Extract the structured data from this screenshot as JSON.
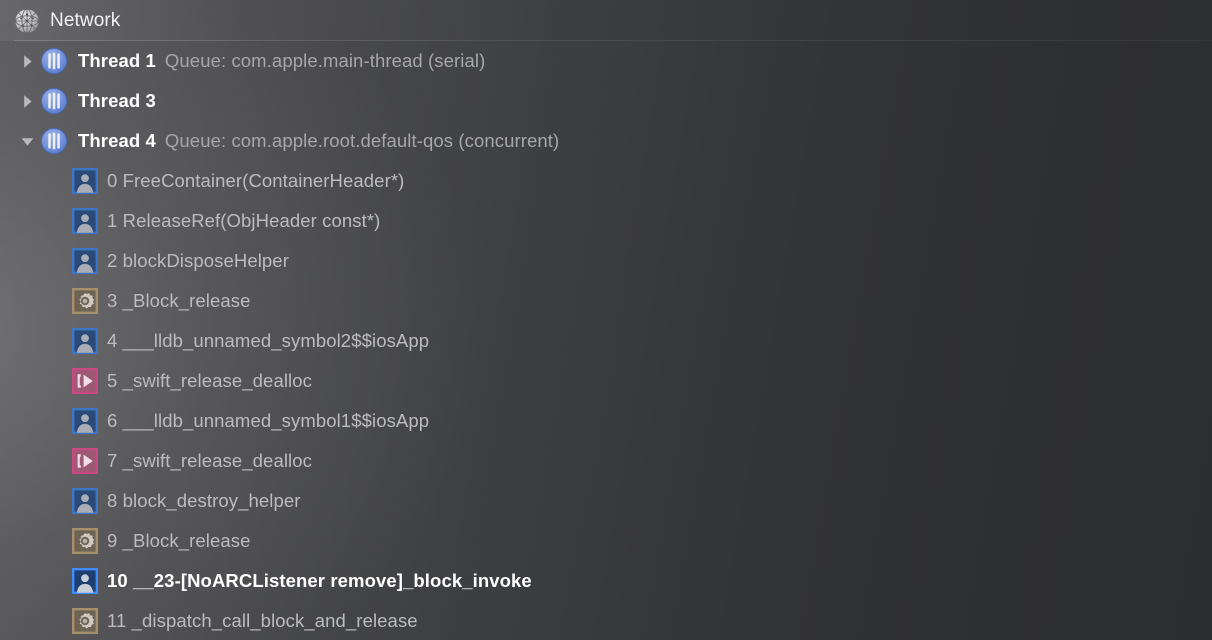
{
  "header": {
    "title": "Network",
    "icon": "network-globe-icon"
  },
  "colors": {
    "accent_blue": "#4a7fd4",
    "thread_icon_blue": "#6f8fd6",
    "system_gear_tan": "#a08a64",
    "runtime_pink": "#c0497c",
    "selected_text": "#ffffff",
    "frame_text": "#bcbcbc",
    "queue_text": "#a7a7a8",
    "background_left": "#5b5b5d",
    "background_right": "#2c2d2f"
  },
  "threads": [
    {
      "name": "Thread 1",
      "queue": "Queue: com.apple.main-thread (serial)",
      "expanded": false,
      "twisty": "chevron-right-icon",
      "icon": "thread-icon"
    },
    {
      "name": "Thread 3",
      "queue": "",
      "expanded": false,
      "twisty": "chevron-right-icon",
      "icon": "thread-icon"
    },
    {
      "name": "Thread 4",
      "queue": "Queue: com.apple.root.default-qos (concurrent)",
      "expanded": true,
      "twisty": "chevron-down-icon",
      "icon": "thread-icon"
    }
  ],
  "frames": [
    {
      "index": "0",
      "label": "0 FreeContainer(ContainerHeader*)",
      "icon": "user-code-icon",
      "selected": false
    },
    {
      "index": "1",
      "label": "1 ReleaseRef(ObjHeader const*)",
      "icon": "user-code-icon",
      "selected": false
    },
    {
      "index": "2",
      "label": "2 blockDisposeHelper",
      "icon": "user-code-icon",
      "selected": false
    },
    {
      "index": "3",
      "label": "3 _Block_release",
      "icon": "system-gear-icon",
      "selected": false
    },
    {
      "index": "4",
      "label": "4 ___lldb_unnamed_symbol2$$iosApp",
      "icon": "user-code-icon",
      "selected": false
    },
    {
      "index": "5",
      "label": "5 _swift_release_dealloc",
      "icon": "runtime-icon",
      "selected": false
    },
    {
      "index": "6",
      "label": "6 ___lldb_unnamed_symbol1$$iosApp",
      "icon": "user-code-icon",
      "selected": false
    },
    {
      "index": "7",
      "label": "7 _swift_release_dealloc",
      "icon": "runtime-icon",
      "selected": false
    },
    {
      "index": "8",
      "label": "8 block_destroy_helper",
      "icon": "user-code-icon",
      "selected": false
    },
    {
      "index": "9",
      "label": "9 _Block_release",
      "icon": "system-gear-icon",
      "selected": false
    },
    {
      "index": "10",
      "label": "10 __23-[NoARCListener remove]_block_invoke",
      "icon": "user-code-icon",
      "selected": true
    },
    {
      "index": "11",
      "label": "11 _dispatch_call_block_and_release",
      "icon": "system-gear-icon",
      "selected": false
    }
  ]
}
